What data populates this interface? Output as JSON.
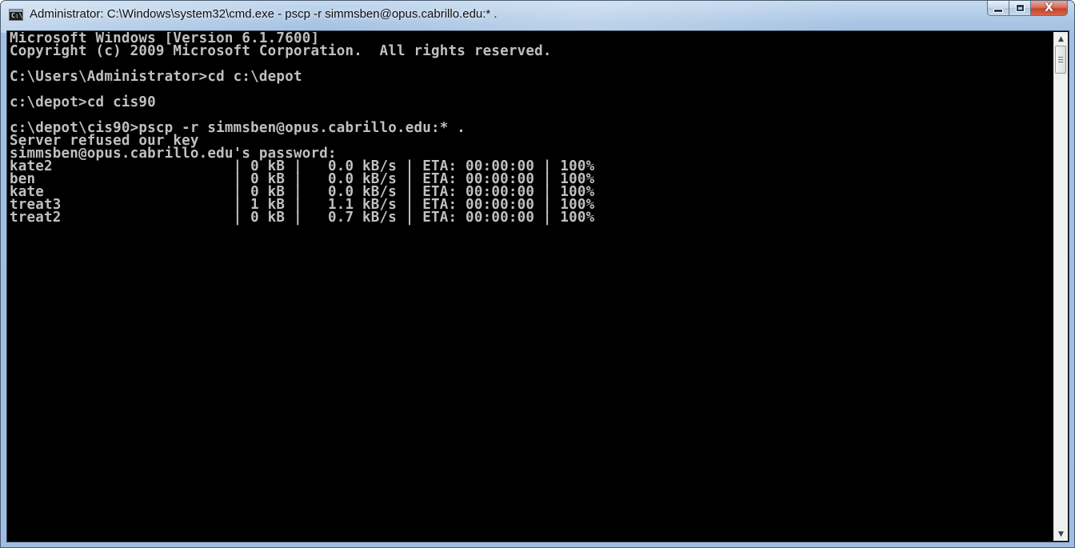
{
  "window": {
    "title": "Administrator: C:\\Windows\\system32\\cmd.exe - pscp  -r simmsben@opus.cabrillo.edu:* .",
    "app_icon_label": "C:\\",
    "close_glyph": "X"
  },
  "scrollbar": {
    "up_arrow": "▲",
    "down_arrow": "▼"
  },
  "console": {
    "lines": [
      "Microsoft Windows [Version 6.1.7600]",
      "Copyright (c) 2009 Microsoft Corporation.  All rights reserved.",
      "",
      "C:\\Users\\Administrator>cd c:\\depot",
      "",
      "c:\\depot>cd cis90",
      "",
      "c:\\depot\\cis90>pscp -r simmsben@opus.cabrillo.edu:* .",
      "Server refused our key",
      "simmsben@opus.cabrillo.edu's password:",
      "kate2                     | 0 kB |   0.0 kB/s | ETA: 00:00:00 | 100%",
      "ben                       | 0 kB |   0.0 kB/s | ETA: 00:00:00 | 100%",
      "kate                      | 0 kB |   0.0 kB/s | ETA: 00:00:00 | 100%",
      "treat3                    | 1 kB |   1.1 kB/s | ETA: 00:00:00 | 100%",
      "treat2                    | 0 kB |   0.7 kB/s | ETA: 00:00:00 | 100%"
    ]
  }
}
